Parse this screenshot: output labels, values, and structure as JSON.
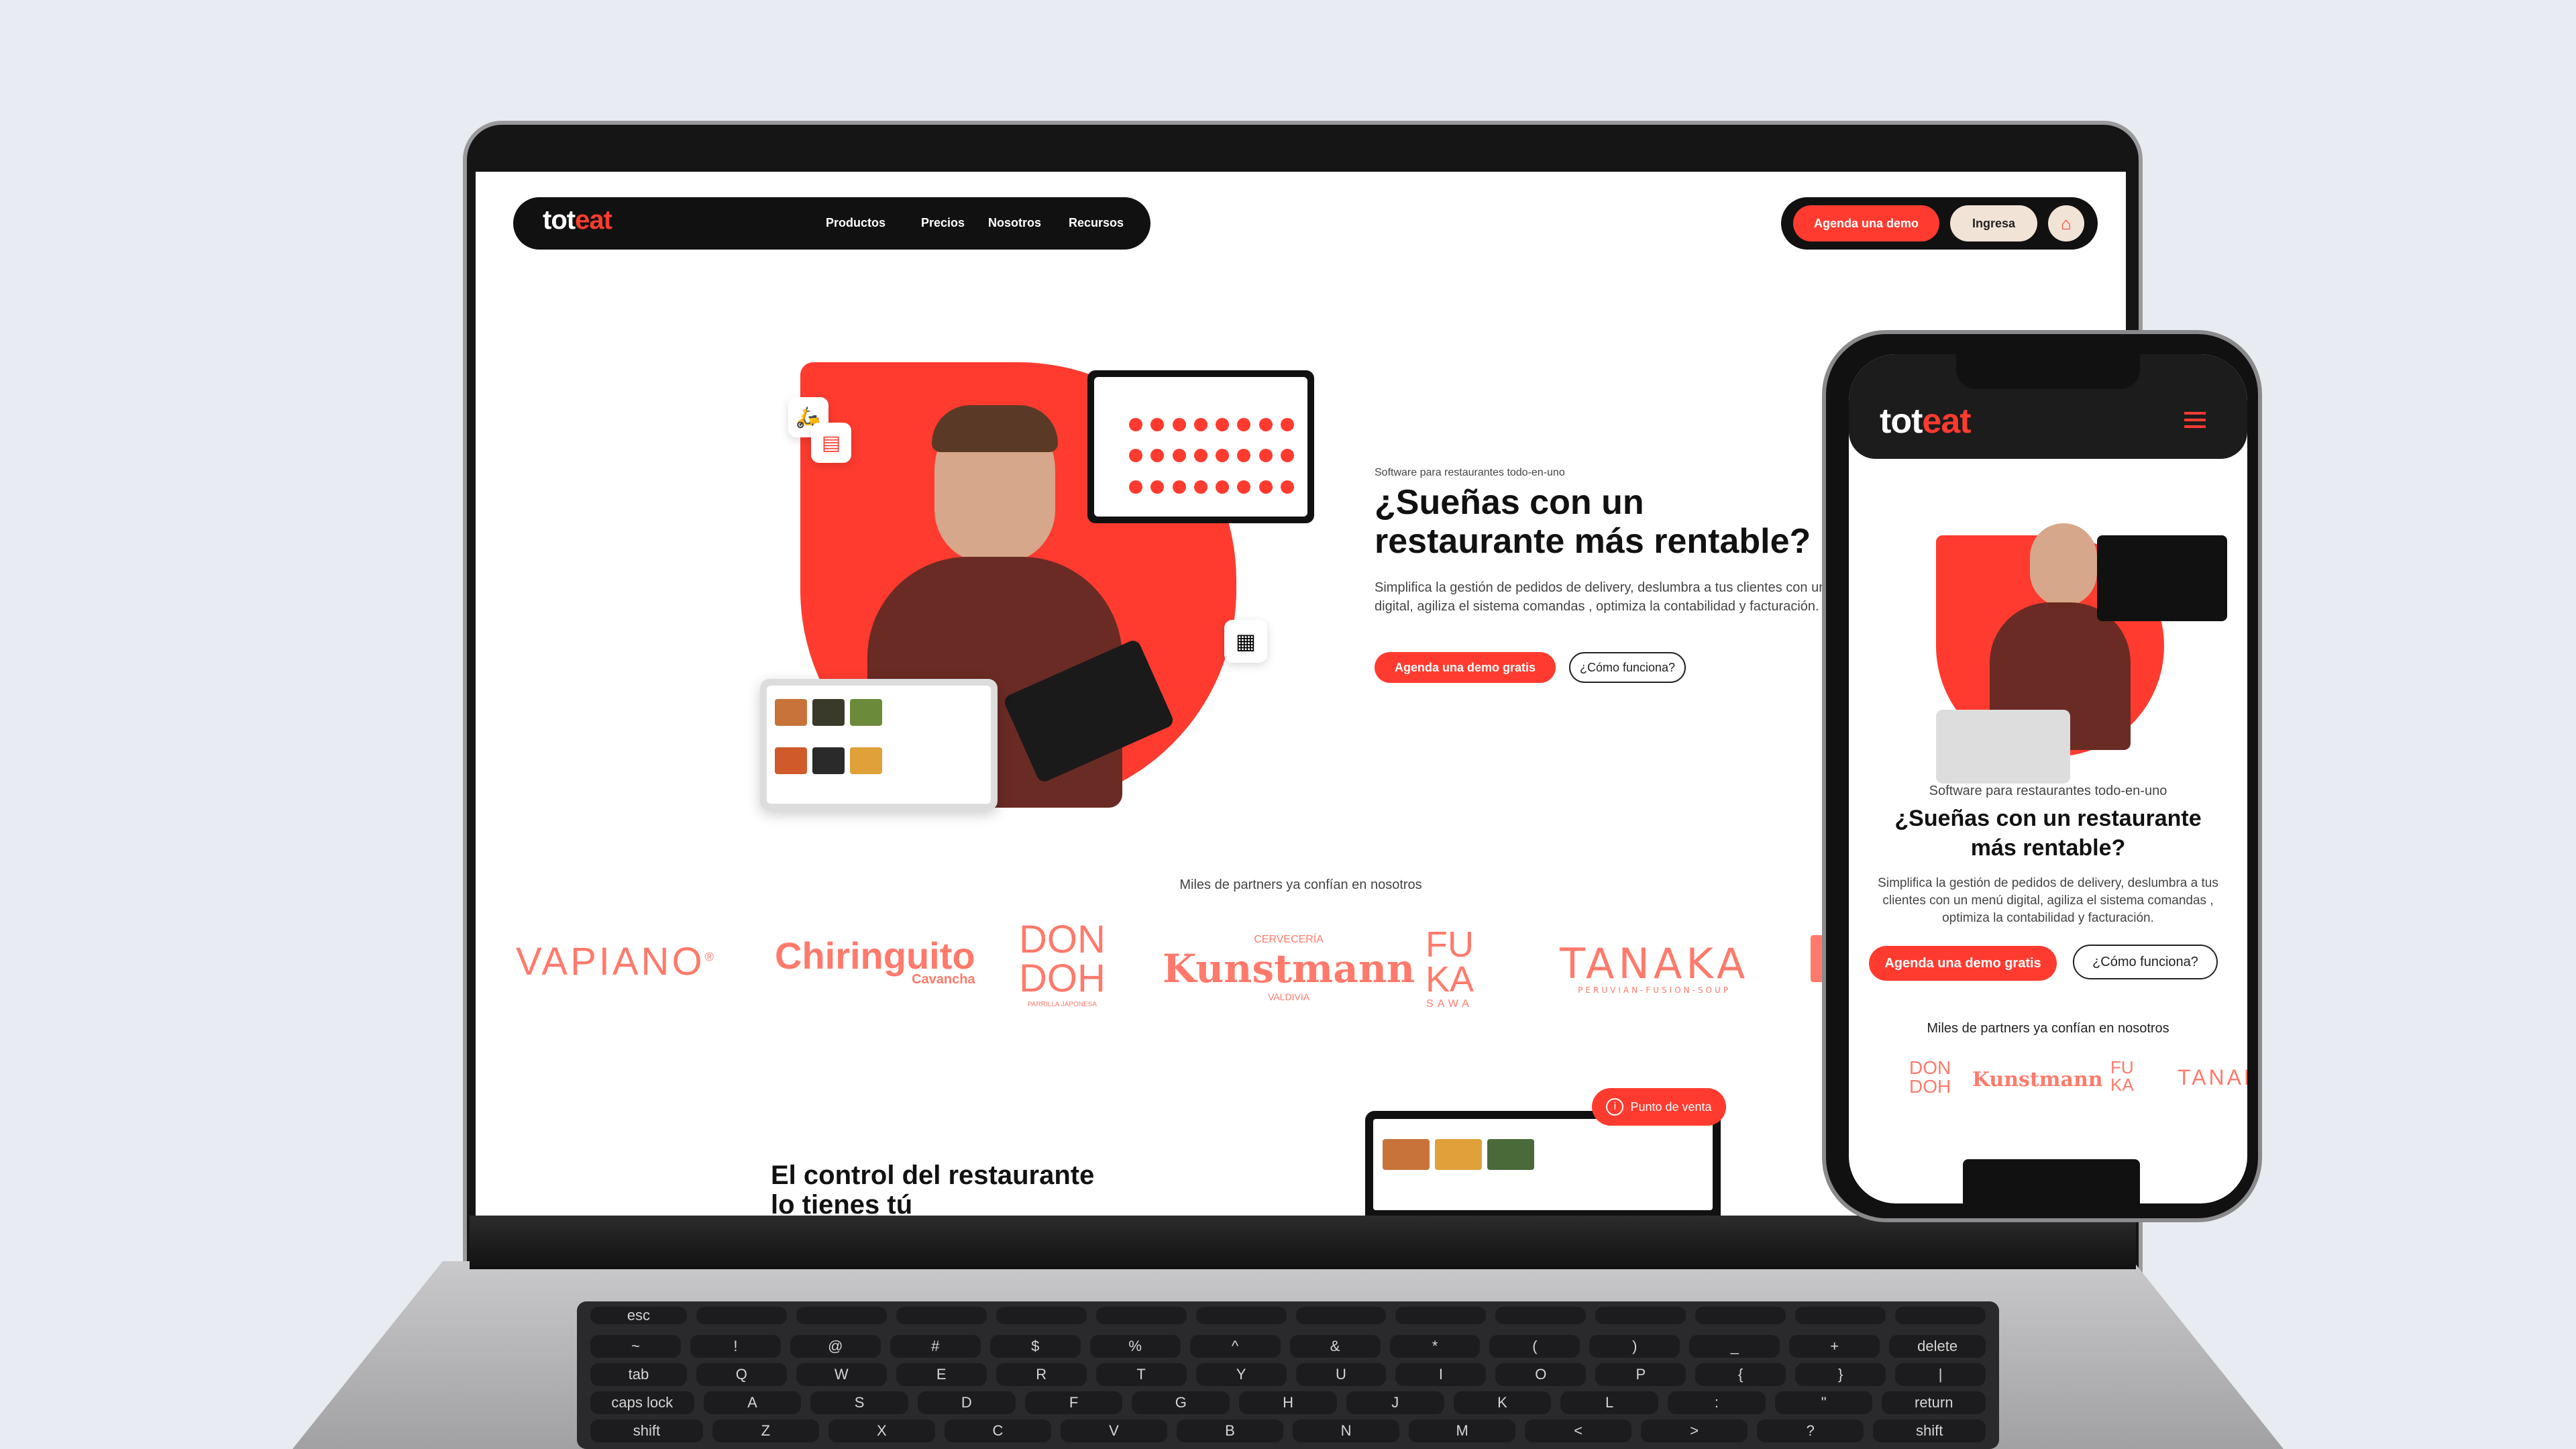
{
  "brand": {
    "logo_a": "tot",
    "logo_b": "eat",
    "accent": "#ff3b2f"
  },
  "nav": {
    "links": [
      "Productos",
      "Precios",
      "Nosotros",
      "Recursos"
    ],
    "demo_button": "Agenda una demo",
    "login_button": "Ingresa"
  },
  "hero": {
    "kicker": "Software para restaurantes todo-en-uno",
    "title_line1": "¿Sueñas con un",
    "title_line2": "restaurante más rentable?",
    "body": "Simplifica la gestión de pedidos de delivery, deslumbra a tus clientes con un menú digital, agiliza el sistema comandas , optimiza la contabilidad y facturación.",
    "cta_primary": "Agenda una demo gratis",
    "cta_secondary": "¿Cómo funciona?"
  },
  "partners": {
    "heading": "Miles de partners ya confían en nosotros",
    "logos": [
      {
        "name": "VAPIANO",
        "sup": "®"
      },
      {
        "name": "Chiringuito",
        "sub": "Cavancha"
      },
      {
        "name_top": "DON",
        "name_bottom": "DOH",
        "sub": "PARRILLA JAPONESA"
      },
      {
        "top": "CERVECERÍA",
        "name": "Kunstmann",
        "sub": "VALDIVIA"
      },
      {
        "name_top": "FU",
        "name_mid": "KA",
        "sub": "SAWA"
      },
      {
        "name": "TANAKA",
        "sub": "PERUVIAN-FUSION-SOUP"
      }
    ]
  },
  "section2": {
    "title_line1": "El control del restaurante",
    "title_line2": "lo tienes tú",
    "badge": "Punto de venta"
  },
  "phone": {
    "kicker": "Software para restaurantes todo-en-uno",
    "title": "¿Sueñas con un restaurante más rentable?",
    "body": "Simplifica la gestión de pedidos de delivery, deslumbra a tus clientes con un menú digital, agiliza el sistema comandas , optimiza la contabilidad y facturación.",
    "cta_primary": "Agenda una demo gratis",
    "cta_secondary": "¿Cómo funciona?",
    "partners_heading": "Miles de partners ya confían en nosotros",
    "partner_labels": [
      "DON",
      "DOH",
      "Kunstmann",
      "FU",
      "KA",
      "TANAKA"
    ]
  },
  "keyboard": {
    "row1": [
      "esc",
      "",
      "",
      "",
      "",
      "",
      "",
      "",
      "",
      "",
      "",
      "",
      "",
      ""
    ],
    "row2": [
      "~",
      "!",
      "@",
      "#",
      "$",
      "%",
      "^",
      "&",
      "*",
      "(",
      ")",
      "_",
      "+",
      "delete"
    ],
    "row3": [
      "tab",
      "Q",
      "W",
      "E",
      "R",
      "T",
      "Y",
      "U",
      "I",
      "O",
      "P",
      "{",
      "}",
      "|"
    ],
    "row4": [
      "caps lock",
      "A",
      "S",
      "D",
      "F",
      "G",
      "H",
      "J",
      "K",
      "L",
      ":",
      "\"",
      "return"
    ],
    "row5": [
      "shift",
      "Z",
      "X",
      "C",
      "V",
      "B",
      "N",
      "M",
      "<",
      ">",
      "?",
      "shift"
    ]
  }
}
